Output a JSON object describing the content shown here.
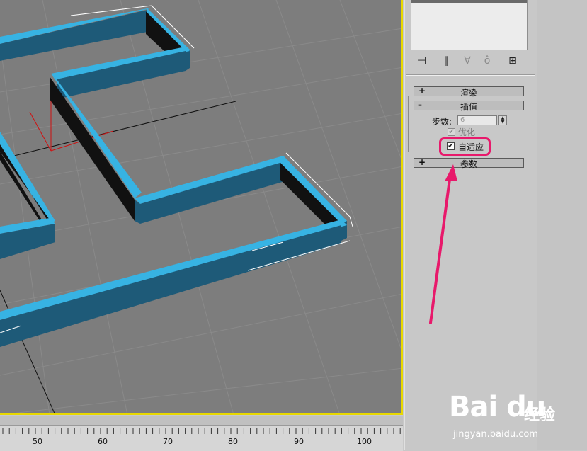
{
  "rollouts": [
    {
      "sign": "+",
      "title": "渲染"
    },
    {
      "sign": "-",
      "title": "插值"
    },
    {
      "sign": "+",
      "title": "参数"
    }
  ],
  "interpolation": {
    "steps_label": "步数:",
    "steps_value": "6",
    "optimize_label": "优化",
    "optimize_checked": "✔",
    "adaptive_label": "自适应",
    "adaptive_checked": "✔"
  },
  "toolbar": {
    "icons": [
      "pin-stack-icon",
      "show-end-result-icon",
      "make-unique-icon",
      "remove-modifier-icon",
      "configure-sets-icon"
    ]
  },
  "timeline": {
    "ticks": [
      "50",
      "60",
      "70",
      "80",
      "90",
      "100"
    ]
  },
  "watermark": {
    "logo": "Bai du",
    "cn": "经验",
    "url": "jingyan.baidu.com"
  },
  "colors": {
    "viewport_bg": "#7d7d7d",
    "wall_top": "#37b3e3",
    "wall_side": "#1e5a78",
    "viewport_border": "#e8d800",
    "annotation": "#e8196b"
  }
}
